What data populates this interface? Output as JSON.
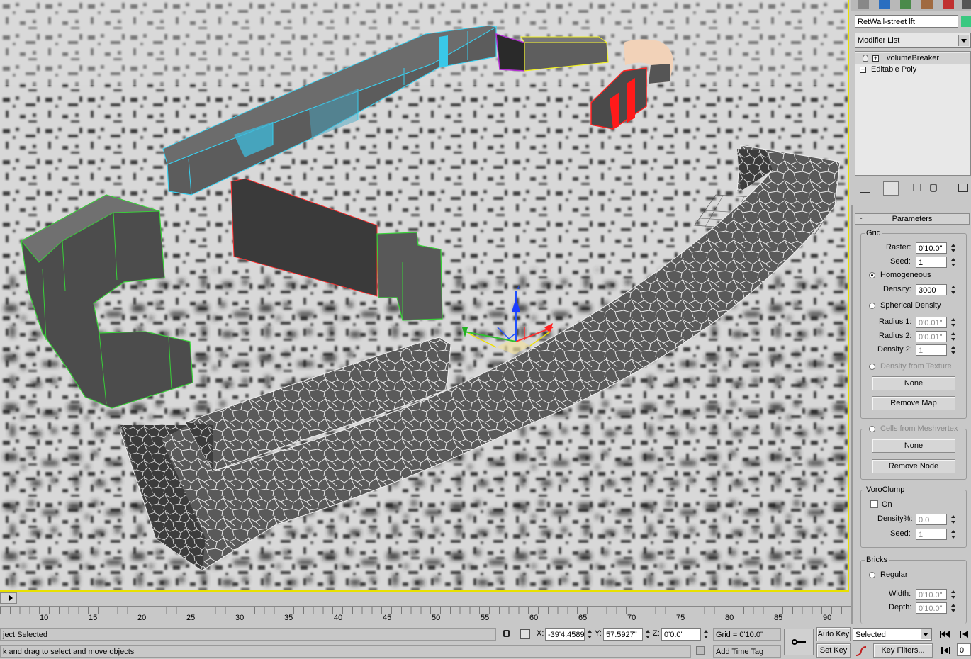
{
  "modify_panel": {
    "object_name": "RetWall-street lft",
    "modifier_list_label": "Modifier List",
    "stack": [
      {
        "label": "volumeBreaker",
        "selected": true
      },
      {
        "label": "Editable Poly",
        "selected": false
      }
    ]
  },
  "parameters": {
    "rollout_title": "Parameters",
    "grid": {
      "group_label": "Grid",
      "raster_label": "Raster:",
      "raster_value": "0'10.0\"",
      "seed_label": "Seed:",
      "seed_value": "1",
      "homogeneous_label": "Homogeneous",
      "density_label": "Density:",
      "density_value": "3000",
      "spherical_density_label": "Spherical Density",
      "radius1_label": "Radius 1:",
      "radius1_value": "0'0.01\"",
      "radius2_label": "Radius 2:",
      "radius2_value": "0'0.01\"",
      "density2_label": "Density 2:",
      "density2_value": "1",
      "density_from_texture_label": "Density from Texture",
      "none_button": "None",
      "remove_map_button": "Remove Map"
    },
    "cells": {
      "label": "Cells from Meshvertex",
      "none_button": "None",
      "remove_node_button": "Remove Node"
    },
    "voroclump": {
      "group_label": "VoroClump",
      "on_label": "On",
      "density_label": "Density%:",
      "density_value": "0.0",
      "seed_label": "Seed:",
      "seed_value": "1"
    },
    "bricks": {
      "group_label": "Bricks",
      "regular_label": "Regular",
      "width_label": "Width:",
      "width_value": "0'10.0\"",
      "depth_label": "Depth:",
      "depth_value": "0'10.0\""
    }
  },
  "timeline": {
    "ticks": [
      "10",
      "15",
      "20",
      "25",
      "30",
      "35",
      "40",
      "45",
      "50",
      "55",
      "60",
      "65",
      "70",
      "75",
      "80",
      "85",
      "90"
    ]
  },
  "status": {
    "selection_text": "ject Selected",
    "prompt_text": "k and drag to select and move objects",
    "x_label": "X:",
    "x_value": "-39'4.4589'",
    "y_label": "Y:",
    "y_value": "57.5927\"",
    "z_label": "Z:",
    "z_value": "0'0.0\"",
    "grid_text": "Grid = 0'10.0\"",
    "add_time_tag": "Add Time Tag",
    "auto_key": "Auto Key",
    "set_key": "Set Key",
    "selected_dropdown": "Selected",
    "key_filters": "Key Filters...",
    "frame_value": "0"
  },
  "colors": {
    "viewport_border": "#e8e000",
    "cyan_wire": "#39d0f0",
    "green_wire": "#38d038",
    "red_wire": "#ff2020",
    "yellow_wire": "#f0f020",
    "purple_wire": "#b030d0"
  }
}
